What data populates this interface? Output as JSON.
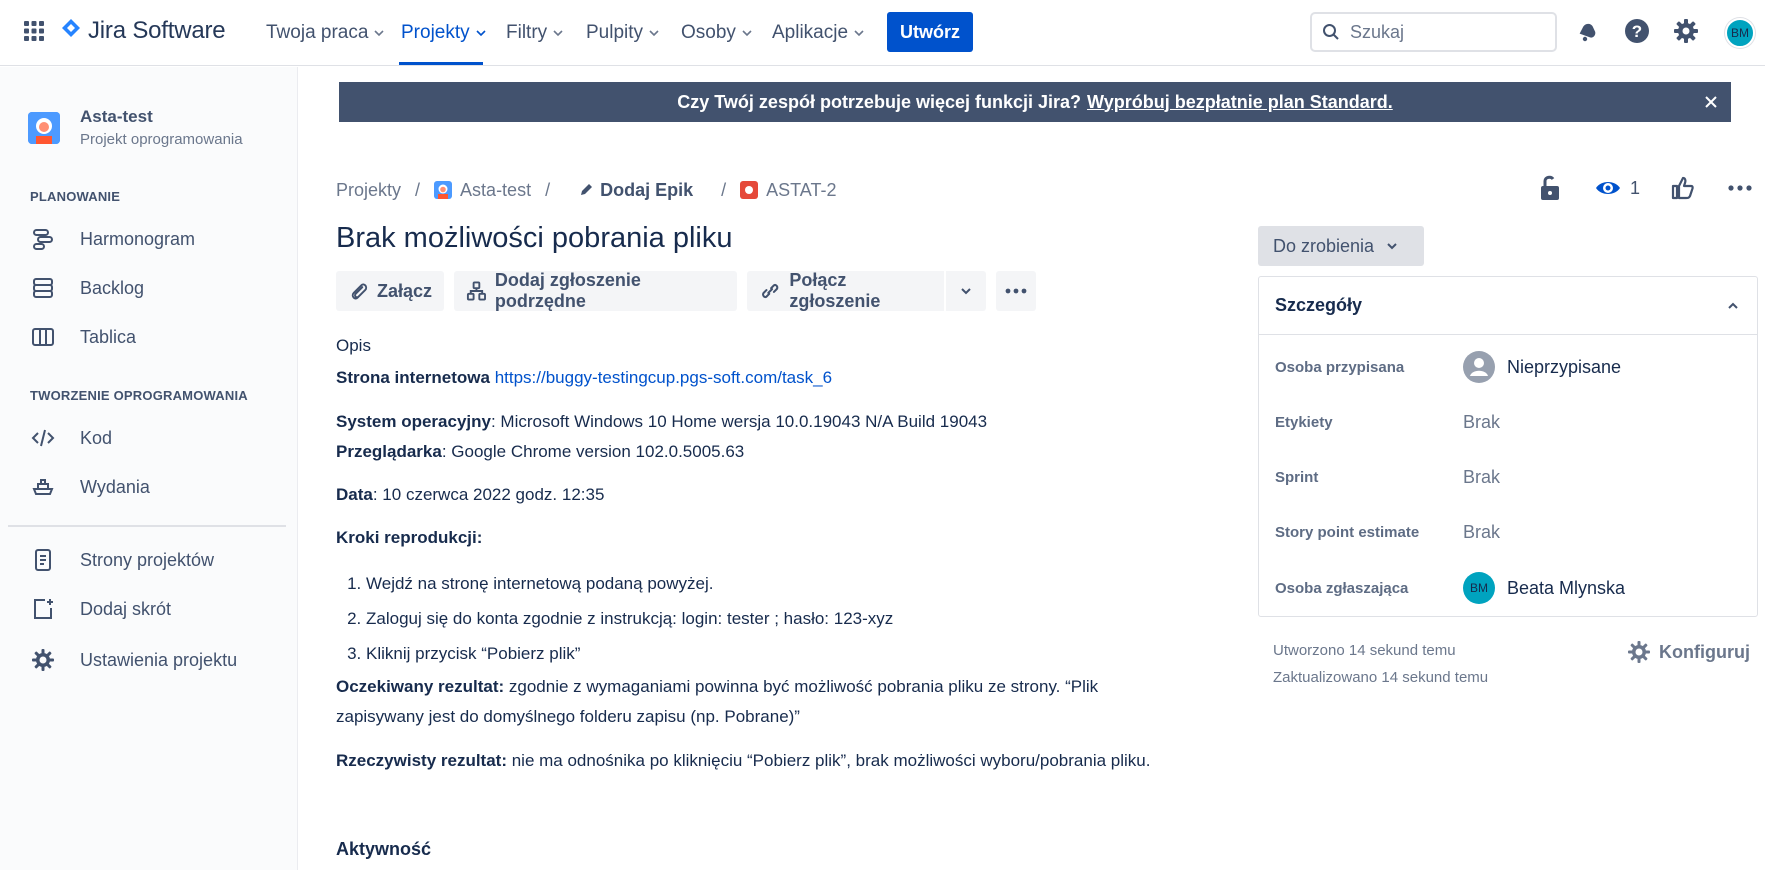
{
  "topnav": {
    "product": "Jira Software",
    "items": [
      {
        "label": "Twoja praca"
      },
      {
        "label": "Projekty"
      },
      {
        "label": "Filtry"
      },
      {
        "label": "Pulpity"
      },
      {
        "label": "Osoby"
      },
      {
        "label": "Aplikacje"
      }
    ],
    "active_item": "Projekty",
    "create_label": "Utwórz",
    "search_placeholder": "Szukaj",
    "user_initials": "BM"
  },
  "sidebar": {
    "project_name": "Asta-test",
    "project_type": "Projekt oprogramowania",
    "planning_heading": "PLANOWANIE",
    "planning_items": [
      {
        "label": "Harmonogram",
        "icon": "roadmap-icon"
      },
      {
        "label": "Backlog",
        "icon": "backlog-icon"
      },
      {
        "label": "Tablica",
        "icon": "board-icon"
      }
    ],
    "dev_heading": "TWORZENIE OPROGRAMOWANIA",
    "dev_items": [
      {
        "label": "Kod",
        "icon": "code-icon"
      },
      {
        "label": "Wydania",
        "icon": "releases-icon"
      }
    ],
    "bottom_items": [
      {
        "label": "Strony projektów",
        "icon": "pages-icon"
      },
      {
        "label": "Dodaj skrót",
        "icon": "add-shortcut-icon"
      },
      {
        "label": "Ustawienia projektu",
        "icon": "settings-icon"
      }
    ]
  },
  "banner": {
    "text": "Czy Twój zespół potrzebuje więcej funkcji Jira?",
    "link": "Wypróbuj bezpłatnie plan Standard."
  },
  "breadcrumb": {
    "projects": "Projekty",
    "project": "Asta-test",
    "epic": "Dodaj Epik",
    "issue_key": "ASTAT-2"
  },
  "header_actions": {
    "watch_count": "1"
  },
  "issue": {
    "title": "Brak możliwości pobrania pliku",
    "actions": {
      "attach": "Załącz",
      "add_child": "Dodaj zgłoszenie podrzędne",
      "link_issue": "Połącz zgłoszenie"
    },
    "description": {
      "heading": "Opis",
      "website_label": "Strona internetowa",
      "website_url": "https://buggy-testingcup.pgs-soft.com/task_6",
      "os_label": "System operacyjny",
      "os_value": ": Microsoft Windows 10 Home wersja 10.0.19043 N/A Build 19043",
      "browser_label": "Przeglądarka",
      "browser_value": ": Google Chrome version 102.0.5005.63",
      "date_label": "Data",
      "date_value": ": 10 czerwca 2022 godz. 12:35",
      "steps_heading": "Kroki reprodukcji:",
      "steps": [
        "Wejdź na stronę internetową podaną powyżej.",
        "Zaloguj się do konta zgodnie z instrukcją: login: tester ; hasło: 123-xyz",
        "Kliknij przycisk “Pobierz plik”"
      ],
      "expected_label": "Oczekiwany rezultat:",
      "expected_value": " zgodnie z wymaganiami powinna być możliwość pobrania pliku ze strony. “Plik zapisywany jest do domyślnego folderu zapisu (np. Pobrane)”",
      "actual_label": "Rzeczywisty rezultat:",
      "actual_value": " nie ma odnośnika po kliknięciu “Pobierz plik”, brak możliwości wyboru/pobrania pliku."
    },
    "activity_heading": "Aktywność"
  },
  "details": {
    "status": "Do zrobienia",
    "heading": "Szczegóły",
    "fields": {
      "assignee_label": "Osoba przypisana",
      "assignee_value": "Nieprzypisane",
      "labels_label": "Etykiety",
      "labels_value": "Brak",
      "sprint_label": "Sprint",
      "sprint_value": "Brak",
      "sp_label": "Story point estimate",
      "sp_value": "Brak",
      "reporter_label": "Osoba zgłaszająca",
      "reporter_value": "Beata Mlynska",
      "reporter_initials": "BM"
    },
    "created": "Utworzono 14 sekund temu",
    "updated": "Zaktualizowano 14 sekund temu",
    "configure": "Konfiguruj"
  },
  "colors": {
    "accent": "#0052cc",
    "banner": "#42526e",
    "avatar": "#00a3bf"
  }
}
